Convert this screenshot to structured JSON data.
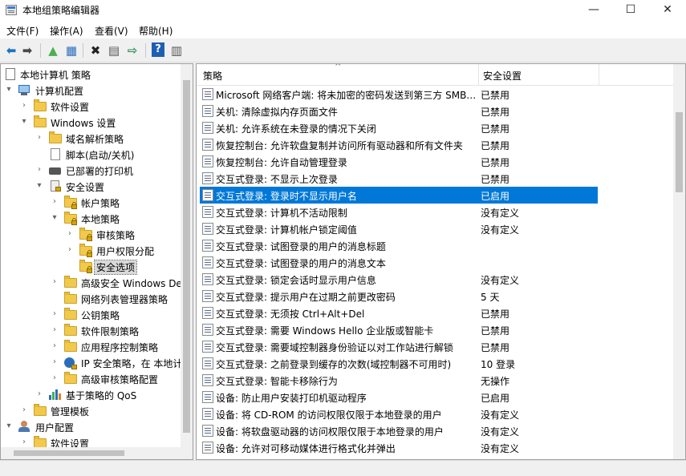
{
  "window": {
    "title": "本地组策略编辑器",
    "minimize": "—",
    "maximize": "☐",
    "close": "✕"
  },
  "menu": [
    "文件(F)",
    "操作(A)",
    "查看(V)",
    "帮助(H)"
  ],
  "toolbar": [
    {
      "name": "back-icon",
      "glyph": "⬅",
      "color": "#1e73be"
    },
    {
      "name": "forward-icon",
      "glyph": "➡",
      "color": "#4a4a4a"
    },
    {
      "name": "up-folder-icon",
      "glyph": "▲",
      "color": "#4caf50"
    },
    {
      "name": "show-hide-tree-icon",
      "glyph": "▦",
      "color": "#2a6ebb"
    },
    {
      "name": "delete-icon",
      "glyph": "✖",
      "color": "#222"
    },
    {
      "name": "properties-icon",
      "glyph": "▤",
      "color": "#555"
    },
    {
      "name": "export-icon",
      "glyph": "⇨",
      "color": "#2e8b57"
    },
    {
      "name": "help-icon",
      "glyph": "?",
      "color": "#fff"
    },
    {
      "name": "view-icon",
      "glyph": "▥",
      "color": "#555"
    }
  ],
  "tree": [
    {
      "label": "本地计算机 策略",
      "level": 0,
      "arrow": "",
      "icon": "policy"
    },
    {
      "label": "计算机配置",
      "level": 1,
      "arrow": "▾",
      "icon": "computer"
    },
    {
      "label": "软件设置",
      "level": 2,
      "arrow": "›",
      "icon": "folder"
    },
    {
      "label": "Windows 设置",
      "level": 2,
      "arrow": "▾",
      "icon": "folder"
    },
    {
      "label": "域名解析策略",
      "level": 3,
      "arrow": "›",
      "icon": "folder"
    },
    {
      "label": "脚本(启动/关机)",
      "level": 3,
      "arrow": "",
      "icon": "script"
    },
    {
      "label": "已部署的打印机",
      "level": 3,
      "arrow": "›",
      "icon": "printer"
    },
    {
      "label": "安全设置",
      "level": 3,
      "arrow": "▾",
      "icon": "security"
    },
    {
      "label": "帐户策略",
      "level": 4,
      "arrow": "›",
      "icon": "lockfolder"
    },
    {
      "label": "本地策略",
      "level": 4,
      "arrow": "▾",
      "icon": "lockfolder"
    },
    {
      "label": "审核策略",
      "level": 5,
      "arrow": "›",
      "icon": "lockfolder"
    },
    {
      "label": "用户权限分配",
      "level": 5,
      "arrow": "›",
      "icon": "lockfolder"
    },
    {
      "label": "安全选项",
      "level": 5,
      "arrow": "",
      "icon": "lockfolder",
      "selected": true
    },
    {
      "label": "高级安全 Windows De",
      "level": 4,
      "arrow": "›",
      "icon": "folder"
    },
    {
      "label": "网络列表管理器策略",
      "level": 4,
      "arrow": "",
      "icon": "folder"
    },
    {
      "label": "公钥策略",
      "level": 4,
      "arrow": "›",
      "icon": "folder"
    },
    {
      "label": "软件限制策略",
      "level": 4,
      "arrow": "›",
      "icon": "folder"
    },
    {
      "label": "应用程序控制策略",
      "level": 4,
      "arrow": "›",
      "icon": "folder"
    },
    {
      "label": "IP 安全策略，在 本地计",
      "level": 4,
      "arrow": "›",
      "icon": "ipsec"
    },
    {
      "label": "高级审核策略配置",
      "level": 4,
      "arrow": "›",
      "icon": "folder"
    },
    {
      "label": "基于策略的 QoS",
      "level": 3,
      "arrow": "›",
      "icon": "chart"
    },
    {
      "label": "管理模板",
      "level": 2,
      "arrow": "›",
      "icon": "folder"
    },
    {
      "label": "用户配置",
      "level": 1,
      "arrow": "▾",
      "icon": "user"
    },
    {
      "label": "软件设置",
      "level": 2,
      "arrow": "›",
      "icon": "folder"
    }
  ],
  "list": {
    "col_policy": "策略",
    "col_setting": "安全设置",
    "rows": [
      {
        "policy": "Microsoft 网络客户端: 将未加密的密码发送到第三方 SMB…",
        "setting": "已禁用"
      },
      {
        "policy": "关机: 清除虚拟内存页面文件",
        "setting": "已禁用"
      },
      {
        "policy": "关机: 允许系统在未登录的情况下关闭",
        "setting": "已禁用"
      },
      {
        "policy": "恢复控制台: 允许软盘复制并访问所有驱动器和所有文件夹",
        "setting": "已禁用"
      },
      {
        "policy": "恢复控制台: 允许自动管理登录",
        "setting": "已禁用"
      },
      {
        "policy": "交互式登录: 不显示上次登录",
        "setting": "已禁用"
      },
      {
        "policy": "交互式登录: 登录时不显示用户名",
        "setting": "已启用",
        "selected": true
      },
      {
        "policy": "交互式登录: 计算机不活动限制",
        "setting": "没有定义"
      },
      {
        "policy": "交互式登录: 计算机帐户锁定阈值",
        "setting": "没有定义"
      },
      {
        "policy": "交互式登录: 试图登录的用户的消息标题",
        "setting": ""
      },
      {
        "policy": "交互式登录: 试图登录的用户的消息文本",
        "setting": ""
      },
      {
        "policy": "交互式登录: 锁定会话时显示用户信息",
        "setting": "没有定义"
      },
      {
        "policy": "交互式登录: 提示用户在过期之前更改密码",
        "setting": "5 天"
      },
      {
        "policy": "交互式登录: 无须按 Ctrl+Alt+Del",
        "setting": "已禁用"
      },
      {
        "policy": "交互式登录: 需要 Windows Hello 企业版或智能卡",
        "setting": "已禁用"
      },
      {
        "policy": "交互式登录: 需要域控制器身份验证以对工作站进行解锁",
        "setting": "已禁用"
      },
      {
        "policy": "交互式登录: 之前登录到缓存的次数(域控制器不可用时)",
        "setting": "10 登录"
      },
      {
        "policy": "交互式登录: 智能卡移除行为",
        "setting": "无操作"
      },
      {
        "policy": "设备: 防止用户安装打印机驱动程序",
        "setting": "已启用"
      },
      {
        "policy": "设备: 将 CD-ROM 的访问权限仅限于本地登录的用户",
        "setting": "没有定义"
      },
      {
        "policy": "设备: 将软盘驱动器的访问权限仅限于本地登录的用户",
        "setting": "没有定义"
      },
      {
        "policy": "设备: 允许对可移动媒体进行格式化并弹出",
        "setting": "没有定义"
      }
    ]
  },
  "colors": {
    "selection": "#0078d7",
    "folder": "#f2c94c"
  }
}
